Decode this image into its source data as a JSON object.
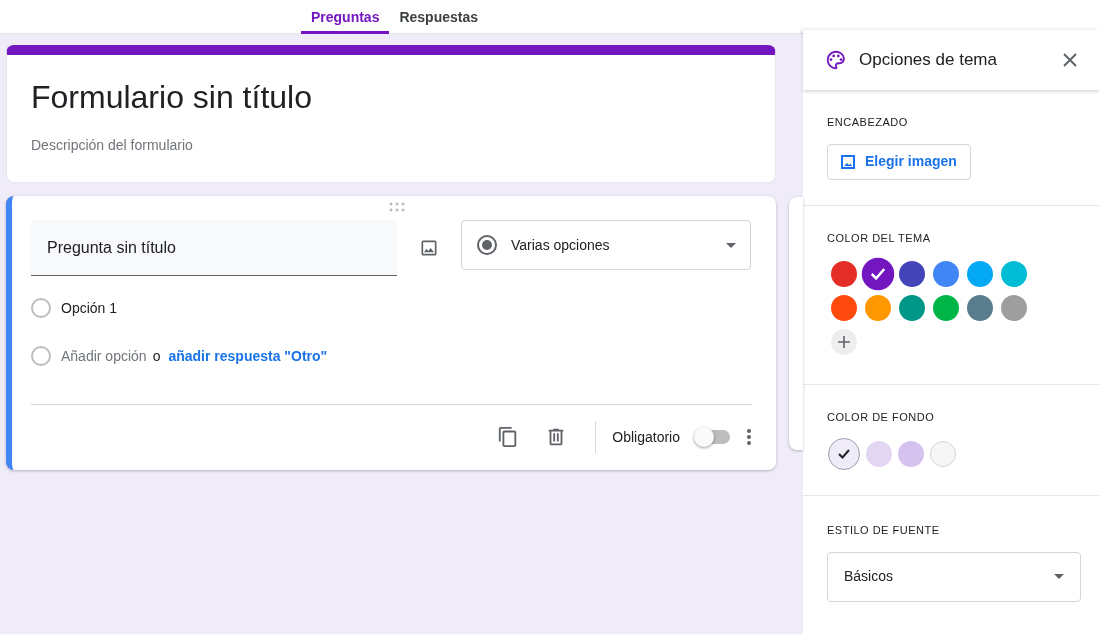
{
  "tabs": [
    {
      "label": "Preguntas",
      "selected": true
    },
    {
      "label": "Respuestas",
      "selected": false
    }
  ],
  "form_header": {
    "title": "Formulario sin título",
    "description": "Descripción del formulario"
  },
  "question": {
    "title": "Pregunta sin título",
    "type": "Varias opciones",
    "options": [
      {
        "label": "Opción 1"
      }
    ],
    "add_option": "Añadir opción",
    "connector": "o",
    "add_other": "añadir respuesta \"Otro\"",
    "required_label": "Obligatorio",
    "required": false
  },
  "theme_panel": {
    "title": "Opciones de tema",
    "header_section": {
      "label": "ENCABEZADO",
      "button": "Elegir imagen"
    },
    "theme_color_section": {
      "label": "COLOR DEL TEMA",
      "colors": [
        {
          "color": "#e52d27",
          "selected": false
        },
        {
          "color": "#7316c0",
          "selected": true
        },
        {
          "color": "#4444b9",
          "selected": false
        },
        {
          "color": "#4285f4",
          "selected": false
        },
        {
          "color": "#03a9f4",
          "selected": false
        },
        {
          "color": "#00bcd4",
          "selected": false
        },
        {
          "color": "#ff4a0f",
          "selected": false
        },
        {
          "color": "#ff9800",
          "selected": false
        },
        {
          "color": "#009688",
          "selected": false
        },
        {
          "color": "#00b548",
          "selected": false
        },
        {
          "color": "#5a7d8d",
          "selected": false
        },
        {
          "color": "#9e9e9e",
          "selected": false
        }
      ]
    },
    "background_section": {
      "label": "COLOR DE FONDO",
      "colors": [
        {
          "color": "#f0ebf8",
          "selected": true
        },
        {
          "color": "#e3d6f3",
          "selected": false
        },
        {
          "color": "#d5c2ee",
          "selected": false
        },
        {
          "color": "#f6f6f6",
          "selected": false
        }
      ]
    },
    "font_section": {
      "label": "ESTILO DE FUENTE",
      "value": "Básicos"
    }
  }
}
